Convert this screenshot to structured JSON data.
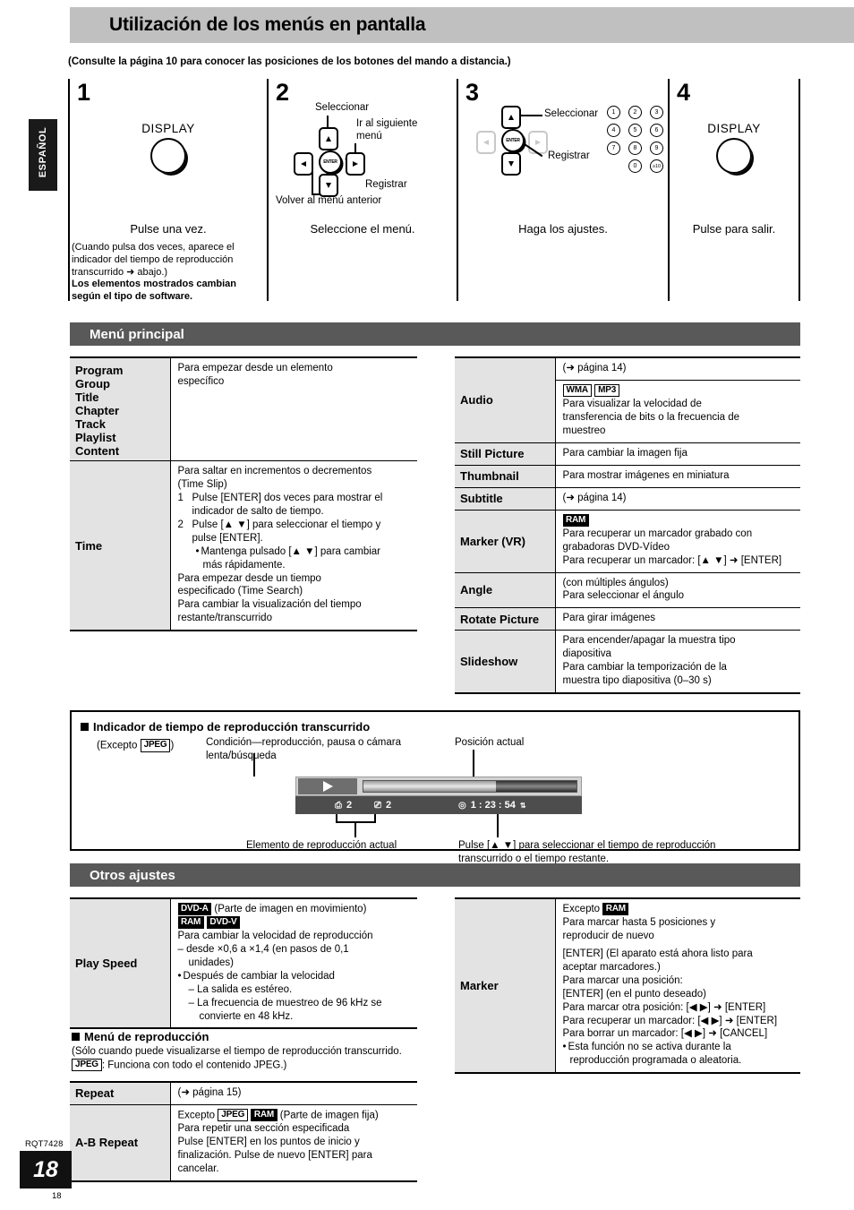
{
  "header": {
    "title": "Utilización de los menús en pantalla",
    "consulte": "(Consulte la página 10 para conocer las posiciones de los botones del mando a distancia.)",
    "side_tab": "ESPAÑOL"
  },
  "steps": [
    {
      "num": "1",
      "display_label": "DISPLAY",
      "caption": "Pulse una vez.",
      "note_line1": "(Cuando pulsa dos veces, aparece el",
      "note_line2": "indicador del tiempo de reproducción",
      "note_line3": "transcurrido ➜ abajo.)",
      "note_bold1": "Los elementos mostrados cambian",
      "note_bold2": "según el tipo de software."
    },
    {
      "num": "2",
      "caption": "Seleccione el menú.",
      "label_select": "Seleccionar",
      "label_next1": "Ir al siguiente",
      "label_next2": "menú",
      "label_register": "Registrar",
      "label_back": "Volver al menú anterior",
      "enter_text": "ENTER"
    },
    {
      "num": "3",
      "caption": "Haga los ajustes.",
      "label_select": "Seleccionar",
      "label_register": "Registrar",
      "enter_text": "ENTER",
      "numpad": [
        "1",
        "2",
        "3",
        "4",
        "5",
        "6",
        "7",
        "8",
        "9",
        "0",
        "≥10"
      ]
    },
    {
      "num": "4",
      "display_label": "DISPLAY",
      "caption": "Pulse para salir."
    }
  ],
  "menu_principal": {
    "section_title": "Menú principal",
    "left_rows": [
      {
        "labels": [
          "Program",
          "Group",
          "Title",
          "Chapter",
          "Track",
          "Playlist",
          "Content"
        ],
        "desc_bold": [
          "Para empezar desde un elemento",
          "específico"
        ]
      },
      {
        "labels": [
          "Time"
        ],
        "time_bold_head": [
          "Para saltar en incrementos o decrementos",
          "(Time Slip)"
        ],
        "time_step1_n": "1",
        "time_step1": [
          "Pulse [ENTER] dos veces para mostrar el",
          "indicador de salto de tiempo."
        ],
        "time_step2_n": "2",
        "time_step2": [
          "Pulse [▲ ▼] para seleccionar el tiempo y",
          "pulse [ENTER]."
        ],
        "time_bullet": [
          "Mantenga pulsado [▲ ▼] para cambiar",
          "más rápidamente."
        ],
        "time_bold2": [
          "Para empezar desde un tiempo",
          "especificado (Time Search)"
        ],
        "time_bold3": [
          "Para cambiar la visualización del tiempo",
          "restante/transcurrido"
        ]
      }
    ],
    "right_rows": [
      {
        "label": "Audio",
        "line_pag": "(➜ página 14)",
        "badges": [
          "WMA",
          "MP3"
        ],
        "desc_bold": [
          "Para visualizar la velocidad de",
          "transferencia de bits o la frecuencia de",
          "muestreo"
        ]
      },
      {
        "label": "Still Picture",
        "desc_bold": [
          "Para cambiar la imagen fija"
        ]
      },
      {
        "label": "Thumbnail",
        "desc_bold": [
          "Para mostrar imágenes en miniatura"
        ]
      },
      {
        "label": "Subtitle",
        "line_pag": "(➜ página 14)"
      },
      {
        "label": "Marker (VR)",
        "badge_inv": "RAM",
        "desc_bold": [
          "Para recuperar un marcador grabado con",
          "grabadoras DVD-Vídeo"
        ],
        "desc_plain": [
          "Para recuperar un marcador:  [▲ ▼] ➜ [ENTER]"
        ]
      },
      {
        "label": "Angle",
        "desc_plain_top": [
          "(con múltiples ángulos)"
        ],
        "desc_bold": [
          "Para seleccionar el ángulo"
        ]
      },
      {
        "label": "Rotate Picture",
        "desc_bold": [
          "Para girar imágenes"
        ]
      },
      {
        "label": "Slideshow",
        "desc_bold": [
          "Para encender/apagar la muestra tipo",
          "diapositiva",
          "Para cambiar la temporización de la",
          "muestra tipo diapositiva (0–30 s)"
        ]
      }
    ]
  },
  "osd": {
    "heading": "Indicador de tiempo de reproducción transcurrido",
    "excepto_prefix": "(Excepto",
    "excepto_badge": "JPEG",
    "excepto_suffix": ")",
    "note_condition": [
      "Condición—reproducción, pausa o cámara",
      "lenta/búsqueda"
    ],
    "note_position": "Posición actual",
    "note_element": "Elemento de reproducción actual",
    "note_press": [
      "Pulse [▲ ▼] para seleccionar el tiempo de reproducción",
      "transcurrido o el tiempo restante."
    ],
    "bar_title_num": "2",
    "bar_chapter_num": "2",
    "bar_time": "1 : 23 : 54"
  },
  "otros_ajustes": {
    "section_title": "Otros ajustes",
    "play_speed": {
      "label": "Play Speed",
      "badge1": "DVD-A",
      "badge1_suffix": "(Parte de imagen en movimiento)",
      "badge2": "RAM",
      "badge3": "DVD-V",
      "bold_line": "Para cambiar la velocidad de reproducción",
      "dash1": [
        "– desde ×0,6 a ×1,4 (en pasos de 0,1",
        "unidades)"
      ],
      "bullet1": "Después de cambiar la velocidad",
      "dash2": "– La salida es estéreo.",
      "dash3": [
        "– La frecuencia de muestreo de 96 kHz se",
        "convierte en 48 kHz."
      ]
    },
    "menu_reproduccion": {
      "heading": "Menú de reproducción",
      "note1": "(Sólo cuando puede visualizarse el tiempo de reproducción transcurrido.",
      "note2_badge": "JPEG",
      "note2": ": Funciona con todo el contenido JPEG.)"
    },
    "repeat": {
      "label": "Repeat",
      "desc": "(➜ página 15)"
    },
    "ab_repeat": {
      "label": "A-B Repeat",
      "excepto_prefix": "Excepto",
      "badge_jpeg": "JPEG",
      "badge_ram": "RAM",
      "excepto_suffix": "(Parte de imagen fija)",
      "bold_line": "Para repetir una sección especificada",
      "plain": [
        "Pulse [ENTER] en los puntos de inicio y",
        "finalización. Pulse de nuevo [ENTER] para",
        "cancelar."
      ]
    },
    "marker": {
      "label": "Marker",
      "excepto_prefix": "Excepto",
      "badge_ram": "RAM",
      "bold_lines": [
        "Para marcar hasta 5 posiciones y",
        "reproducir de nuevo"
      ],
      "p1": [
        "[ENTER] (El aparato está ahora listo para",
        "aceptar marcadores.)"
      ],
      "p2": "Para marcar una posición:",
      "p3": "[ENTER] (en el punto deseado)",
      "p4": "Para marcar otra posición:  [◀ ▶] ➜ [ENTER]",
      "p5": "Para recuperar un marcador:  [◀ ▶] ➜ [ENTER]",
      "p6": "Para borrar un marcador:  [◀ ▶] ➜ [CANCEL]",
      "bullet": [
        "Esta función no se activa durante la",
        "reproducción programada o aleatoria."
      ]
    }
  },
  "footer": {
    "rqt": "RQT7428",
    "page_big": "18",
    "page_small": "18"
  }
}
